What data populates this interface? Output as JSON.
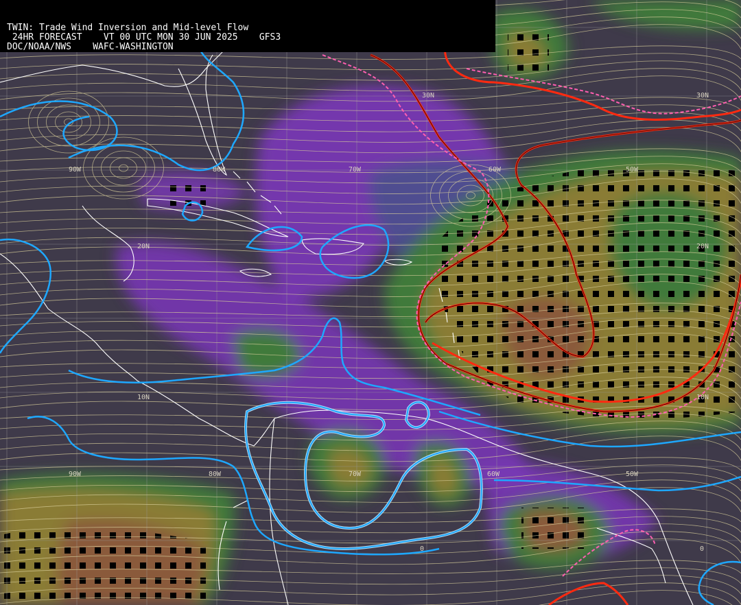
{
  "header": {
    "line1": "TWIN: Trade Wind Inversion and Mid-level Flow",
    "line2": " 24HR FORECAST    VT 00 UTC MON 30 JUN 2025    GFS3",
    "line3": "DOC/NOAA/NWS    WAFC-WASHINGTON"
  },
  "grid_labels": {
    "lat": [
      "30N",
      "20N",
      "10N",
      "0"
    ],
    "lon": [
      "90W",
      "80W",
      "70W",
      "60W",
      "50W"
    ]
  },
  "colors": {
    "background": "#3f3a4a",
    "violet": "#7a37b8",
    "slate_blue": "#4a4f8e",
    "green": "#3f7a3a",
    "olive": "#8a7c36",
    "brown": "#8a5a3a",
    "streamline": "#d9cf9b",
    "contour_cyan": "#1ea8ff",
    "contour_red": "#ff2a10",
    "contour_pink_dash": "#ff5fb0",
    "coastline": "#ffffff",
    "graticule": "#9a9a9a"
  }
}
